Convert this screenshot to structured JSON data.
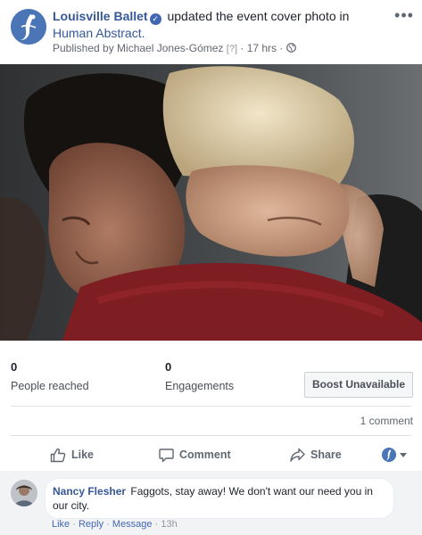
{
  "post": {
    "page_name": "Louisville Ballet",
    "action_text": "updated the event cover photo in",
    "event_name": "Human Abstract.",
    "published_by": "Published by Michael Jones-Gómez",
    "help_marker": "[?]",
    "separator": "·",
    "time": "17 hrs",
    "audience_icon": "globe-icon",
    "more_icon": "ellipsis-icon"
  },
  "insights": {
    "reached_value": "0",
    "reached_label": "People reached",
    "engagements_value": "0",
    "engagements_label": "Engagements",
    "boost_label": "Boost Unavailable"
  },
  "comment_count": "1 comment",
  "actions": {
    "like": "Like",
    "comment": "Comment",
    "share": "Share"
  },
  "comment": {
    "author": "Nancy Flesher",
    "text": "Faggots, stay away! We don't want our need you in our city.",
    "like": "Like",
    "reply": "Reply",
    "message": "Message",
    "time": "13h",
    "dot": "·"
  },
  "colors": {
    "link": "#365899",
    "brand": "#4267b2",
    "meta": "#616770",
    "comments_bg": "#f2f3f5"
  }
}
